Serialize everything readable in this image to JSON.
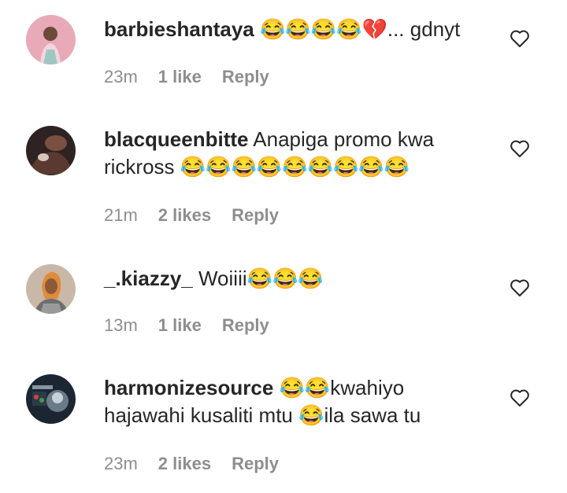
{
  "comments": [
    {
      "username": "barbieshantaya",
      "line1": "😂😂😂😂💔... gdnyt",
      "line2": "",
      "time": "23m",
      "likes": "1 like",
      "reply": "Reply",
      "avatar_color": "#d98aa0"
    },
    {
      "username": "blacqueenbitte",
      "line1": "Anapiga promo kwa",
      "line2": "rickross 😂😂😂😂😂😂😂😂😂",
      "time": "21m",
      "likes": "2 likes",
      "reply": "Reply",
      "avatar_color": "#4a3a3a"
    },
    {
      "username": "_.kiazzy_",
      "line1": "Woiiii😂😂😂",
      "line2": "",
      "time": "13m",
      "likes": "1 like",
      "reply": "Reply",
      "avatar_color": "#b58a6a"
    },
    {
      "username": "harmonizesource",
      "line1": "😂😂kwahiyo",
      "line2": "hajawahi kusaliti mtu 😂ila sawa tu",
      "time": "23m",
      "likes": "2 likes",
      "reply": "Reply",
      "avatar_color": "#1f2b3a"
    }
  ],
  "icons": {
    "like": "heart-outline-icon"
  },
  "colors": {
    "text": "#262626",
    "meta": "#8e8e8e",
    "background": "#ffffff"
  }
}
